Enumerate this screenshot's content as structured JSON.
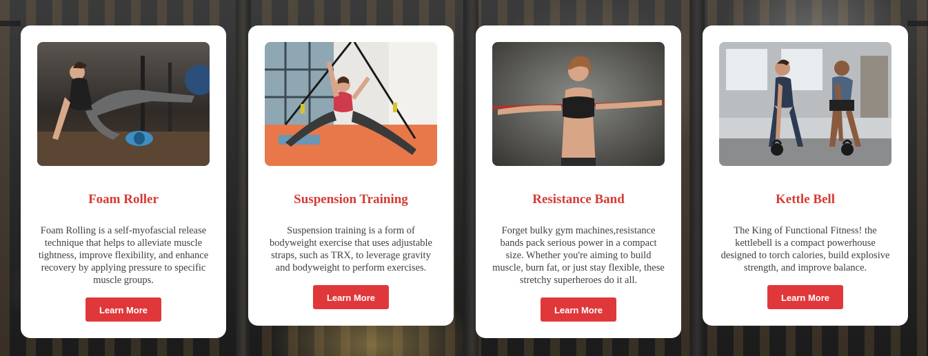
{
  "colors": {
    "accent": "#e0383a",
    "title": "#d63a34",
    "text": "#3e3e3e",
    "card_bg": "#ffffff"
  },
  "cards": [
    {
      "title": "Foam Roller",
      "description": "Foam Rolling is a self-myofascial release technique that helps to alleviate muscle tightness, improve flexibility, and enhance recovery by applying pressure to specific muscle groups.",
      "button_label": "Learn More",
      "image": "woman-using-foam-roller-photo"
    },
    {
      "title": "Suspension Training",
      "description": "Suspension training is a form of bodyweight exercise that uses adjustable straps, such as TRX, to leverage gravity and bodyweight to perform exercises.",
      "button_label": "Learn More",
      "image": "woman-trx-straps-photo"
    },
    {
      "title": "Resistance Band",
      "description": "Forget bulky gym machines,resistance bands pack serious power in a compact size. Whether you're aiming to build muscle, burn fat, or just stay flexible, these stretchy superheroes do it all.",
      "button_label": "Learn More",
      "image": "woman-stretching-resistance-band-photo"
    },
    {
      "title": "Kettle Bell",
      "description": "The King of Functional Fitness! the kettlebell is a compact powerhouse designed to torch calories, build explosive strength, and improve balance.",
      "button_label": "Learn More",
      "image": "couple-kettlebell-workout-photo"
    }
  ]
}
